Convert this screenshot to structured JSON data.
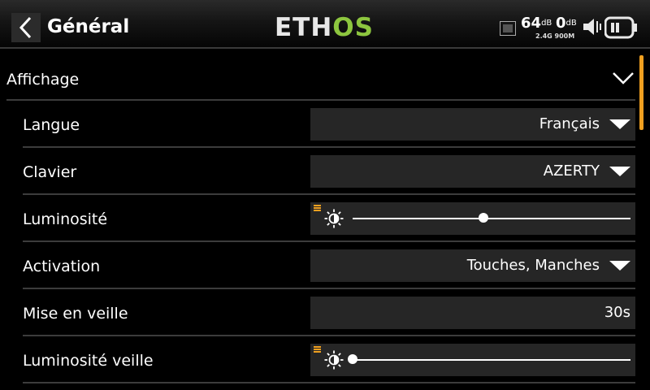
{
  "header": {
    "title": "Général",
    "logo_left": "ETH",
    "logo_right": "OS",
    "rssi_24": "64",
    "rssi_24_unit": "dB",
    "rssi_900": "0",
    "rssi_900_unit": "dB",
    "band_label": "2.4G 900M",
    "icons": [
      "back-arrow-icon",
      "rf-module-icon",
      "speaker-icon",
      "battery-icon"
    ]
  },
  "section": {
    "label": "Affichage",
    "expanded": true
  },
  "settings": [
    {
      "label": "Langue",
      "value": "Français",
      "type": "dropdown"
    },
    {
      "label": "Clavier",
      "value": "AZERTY",
      "type": "dropdown"
    },
    {
      "label": "Luminosité",
      "type": "slider",
      "level": 0.47
    },
    {
      "label": "Activation",
      "value": "Touches, Manches",
      "type": "dropdown"
    },
    {
      "label": "Mise en veille",
      "value": "30s",
      "type": "number"
    },
    {
      "label": "Luminosité veille",
      "type": "slider",
      "level": 0.0
    }
  ],
  "colors": {
    "accent": "#f0a020",
    "logo_green": "#8dc63f",
    "field_bg": "#262626"
  }
}
